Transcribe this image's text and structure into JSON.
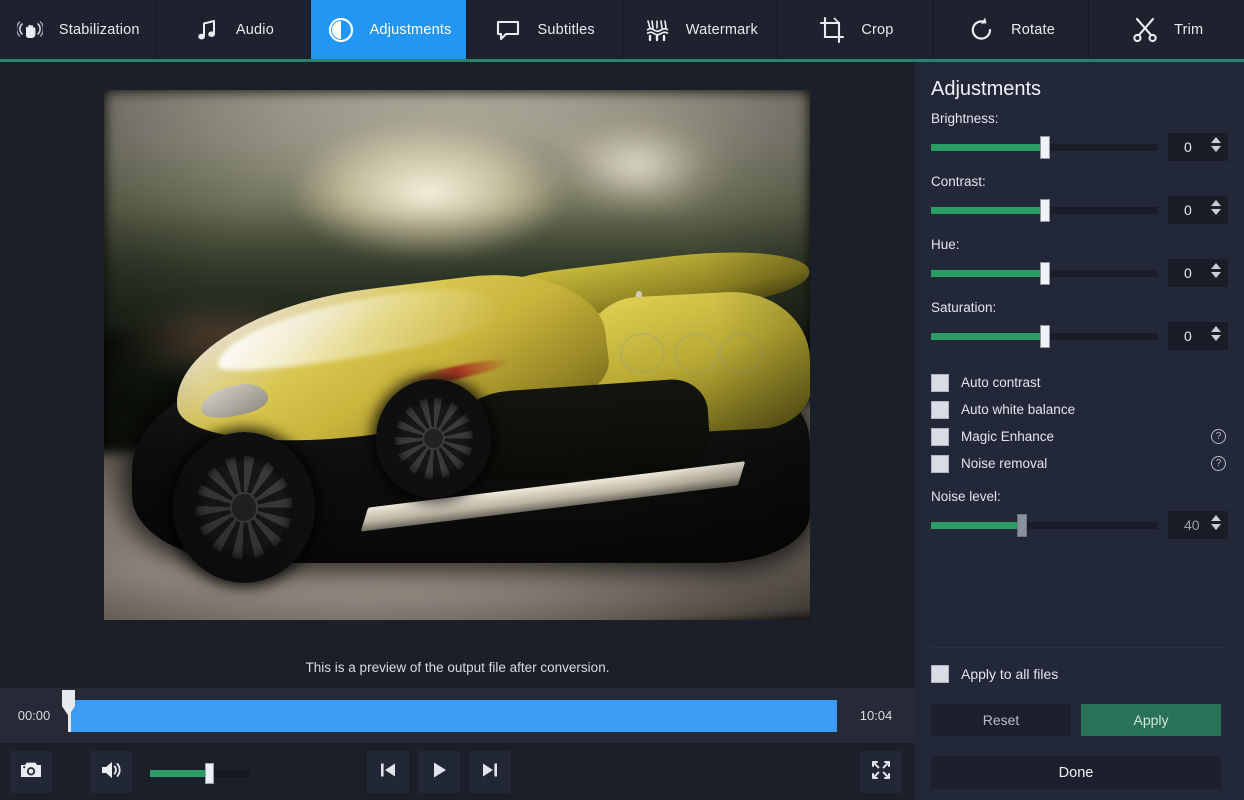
{
  "toolbar": {
    "tabs": [
      {
        "label": "Stabilization",
        "icon": "hand-stabilize-icon",
        "active": false
      },
      {
        "label": "Audio",
        "icon": "music-note-icon",
        "active": false
      },
      {
        "label": "Adjustments",
        "icon": "contrast-circle-icon",
        "active": true
      },
      {
        "label": "Subtitles",
        "icon": "speech-bubble-icon",
        "active": false
      },
      {
        "label": "Watermark",
        "icon": "watermark-icon",
        "active": false
      },
      {
        "label": "Crop",
        "icon": "crop-icon",
        "active": false
      },
      {
        "label": "Rotate",
        "icon": "rotate-icon",
        "active": false
      },
      {
        "label": "Trim",
        "icon": "scissors-icon",
        "active": false
      }
    ],
    "active_tab_color": "#2196f3",
    "underline_color": "#2f7f6e"
  },
  "preview": {
    "caption": "This is a preview of the output file after conversion.",
    "image_description": "Yellow sports car driving on a blurred road at sunset"
  },
  "timeline": {
    "start_time": "00:00",
    "end_time": "10:04",
    "playhead_position_percent": 0,
    "fill_color": "#3d9bf5"
  },
  "playback": {
    "snapshot_icon": "camera-icon",
    "volume_icon": "speaker-icon",
    "volume_percent": 58,
    "previous_icon": "previous-frame-icon",
    "play_icon": "play-icon",
    "next_icon": "next-frame-icon",
    "fullscreen_icon": "fullscreen-icon"
  },
  "panel": {
    "title": "Adjustments",
    "sliders": [
      {
        "label": "Brightness:",
        "value": "0",
        "fill_percent": 50,
        "disabled": false
      },
      {
        "label": "Contrast:",
        "value": "0",
        "fill_percent": 50,
        "disabled": false
      },
      {
        "label": "Hue:",
        "value": "0",
        "fill_percent": 50,
        "disabled": false
      },
      {
        "label": "Saturation:",
        "value": "0",
        "fill_percent": 50,
        "disabled": false
      }
    ],
    "checkboxes": [
      {
        "label": "Auto contrast",
        "checked": false,
        "help": false
      },
      {
        "label": "Auto white balance",
        "checked": false,
        "help": false
      },
      {
        "label": "Magic Enhance",
        "checked": false,
        "help": true
      },
      {
        "label": "Noise removal",
        "checked": false,
        "help": true
      }
    ],
    "noise": {
      "label": "Noise level:",
      "value": "40",
      "fill_percent": 40,
      "disabled": true
    },
    "apply_to_all": {
      "label": "Apply to all files",
      "checked": false
    },
    "buttons": {
      "reset": "Reset",
      "apply": "Apply",
      "done": "Done"
    },
    "accent_green": "#2a9d62",
    "apply_button_color": "#2a7257",
    "background": "#222838"
  }
}
